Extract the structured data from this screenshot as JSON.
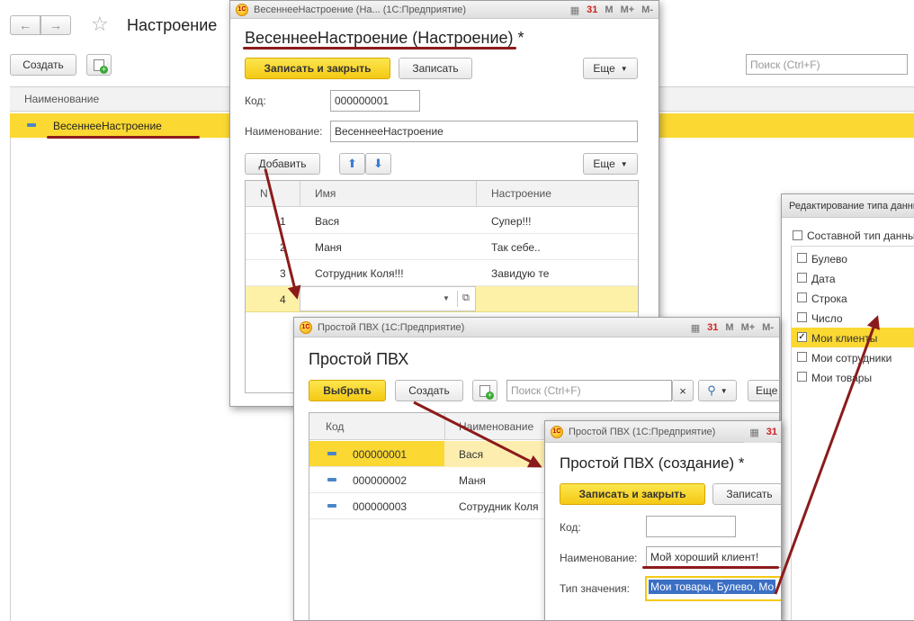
{
  "main": {
    "title": "Настроение",
    "create_label": "Создать",
    "search_placeholder": "Поиск (Ctrl+F)",
    "column_name": "Наименование",
    "rows": [
      {
        "name": "ВесеннееНастроение"
      }
    ]
  },
  "item_form": {
    "window_title": "ВесеннееНастроение (На... (1С:Предприятие)",
    "title": "ВесеннееНастроение (Настроение) *",
    "save_close_label": "Записать и закрыть",
    "save_label": "Записать",
    "more_label": "Еще",
    "code_label": "Код:",
    "code_value": "000000001",
    "name_label": "Наименование:",
    "name_value": "ВесеннееНастроение",
    "add_label": "Добавить",
    "more2_label": "Еще",
    "table": {
      "col_n": "N",
      "col_name": "Имя",
      "col_mood": "Настроение",
      "rows": [
        {
          "n": "1",
          "name": "Вася",
          "mood": "Супер!!!"
        },
        {
          "n": "2",
          "name": "Маня",
          "mood": "Так себе.."
        },
        {
          "n": "3",
          "name": "Сотрудник Коля!!!",
          "mood": "Завидую те"
        },
        {
          "n": "4",
          "name": "",
          "mood": ""
        }
      ]
    }
  },
  "pvh_list": {
    "window_title": "Простой ПВХ (1С:Предприятие)",
    "title": "Простой ПВХ",
    "select_label": "Выбрать",
    "create_label": "Создать",
    "search_placeholder": "Поиск (Ctrl+F)",
    "clear_glyph": "×",
    "more_label": "Еще",
    "col_code": "Код",
    "col_name": "Наименование",
    "rows": [
      {
        "code": "000000001",
        "name": "Вася"
      },
      {
        "code": "000000002",
        "name": "Маня"
      },
      {
        "code": "000000003",
        "name": "Сотрудник Коля"
      }
    ]
  },
  "pvh_create": {
    "window_title": "Простой ПВХ (1С:Предприятие)",
    "title": "Простой ПВХ (создание) *",
    "save_close_label": "Записать и закрыть",
    "save_label": "Записать",
    "code_label": "Код:",
    "name_label": "Наименование:",
    "name_value": "Мой хороший клиент!",
    "type_label": "Тип значения:",
    "type_value": "Мои товары, Булево, Мо"
  },
  "type_dialog": {
    "title": "Редактирование типа данных",
    "composite_label": "Составной тип данных",
    "types": [
      {
        "label": "Булево",
        "checked": false
      },
      {
        "label": "Дата",
        "checked": false
      },
      {
        "label": "Строка",
        "checked": false
      },
      {
        "label": "Число",
        "checked": false
      },
      {
        "label": "Мои клиенты",
        "checked": true
      },
      {
        "label": "Мои сотрудники",
        "checked": false
      },
      {
        "label": "Мои товары",
        "checked": false
      }
    ]
  },
  "icons": {
    "back": "arrow-left-icon",
    "forward": "arrow-right-icon",
    "star": "star-icon",
    "copy": "copy-add-icon",
    "up": "arrow-up-icon",
    "down": "arrow-down-icon",
    "search": "search-icon",
    "dropdown": "chevron-down-icon",
    "open": "open-icon",
    "calc": "calculator-icon",
    "calendar": "calendar-icon"
  },
  "toolbar_glyphs": {
    "m": "M",
    "mplus": "M+",
    "mminus": "M-",
    "cal": "31"
  },
  "colors": {
    "accent_yellow": "#f4c914",
    "row_highlight": "#fbd832",
    "annotation": "#8b1b1b",
    "selection_blue": "#3b6fc4"
  }
}
